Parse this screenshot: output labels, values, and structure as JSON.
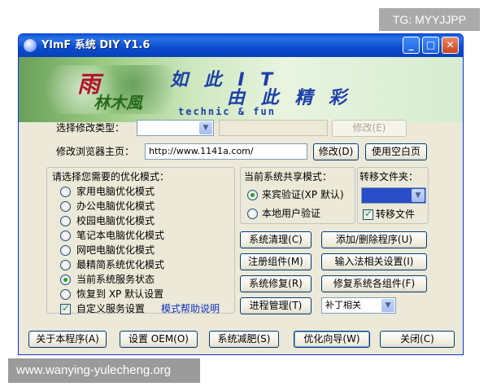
{
  "watermarks": {
    "top": "TG: MYYJJPP",
    "bottom": "www.wanying-yulecheng.org"
  },
  "window": {
    "title": "YlmF 系统 DIY Y1.6",
    "min_symbol": "_",
    "max_symbol": "□",
    "close_symbol": "✕"
  },
  "banner": {
    "logo_text": "雨",
    "logo_text2": "林木風",
    "slogan_line1": "如 此 I T",
    "slogan_line2": "由 此 精 彩",
    "slogan_en": "technic & fun"
  },
  "type_row": {
    "label": "选择修改类型：",
    "combo_value": "",
    "text_value": "",
    "modify_button": "修改(E)"
  },
  "homepage_row": {
    "label": "修改浏览器主页：",
    "url": "http://www.1141a.com/",
    "modify_button": "修改(D)",
    "blank_button": "使用空白页"
  },
  "modes": {
    "title": "请选择您需要的优化模式：",
    "options": [
      {
        "label": "家用电脑优化模式",
        "selected": false
      },
      {
        "label": "办公电脑优化模式",
        "selected": false
      },
      {
        "label": "校园电脑优化模式",
        "selected": false
      },
      {
        "label": "笔记本电脑优化模式",
        "selected": false
      },
      {
        "label": "网吧电脑优化模式",
        "selected": false
      },
      {
        "label": "最精简系统优化模式",
        "selected": false
      },
      {
        "label": "当前系统服务状态",
        "selected": true
      },
      {
        "label": "恢复到 XP 默认设置",
        "selected": false
      }
    ],
    "custom_label": "自定义服务设置",
    "custom_checked": true,
    "help_link": "模式帮助说明"
  },
  "share": {
    "title": "当前系统共享模式：",
    "options": [
      {
        "label": "来宾验证(XP 默认)",
        "selected": true
      },
      {
        "label": "本地用户验证",
        "selected": false
      }
    ]
  },
  "transfer": {
    "title": "转移文件夹：",
    "combo_value": "",
    "checkbox_label": "转移文件",
    "checked": true
  },
  "actions": [
    {
      "label": "系统清理(C)"
    },
    {
      "label": "添加/删除程序(U)"
    },
    {
      "label": "注册组件(M)"
    },
    {
      "label": "输入法相关设置(I)"
    },
    {
      "label": "系统修复(R)"
    },
    {
      "label": "修复系统各组件(F)"
    },
    {
      "label": "进程管理(T)"
    }
  ],
  "patch_combo": {
    "value": "补丁相关"
  },
  "bottom_buttons": [
    {
      "label": "关于本程序(A)"
    },
    {
      "label": "设置 OEM(O)"
    },
    {
      "label": "系统减肥(S)"
    },
    {
      "label": "优化向导(W)"
    },
    {
      "label": "关闭(C)"
    }
  ],
  "colors": {
    "titlebar": "#0a4cd0",
    "window_bg": "#ece9d8",
    "link": "#1030c0",
    "radio_dot": "#21a121"
  }
}
